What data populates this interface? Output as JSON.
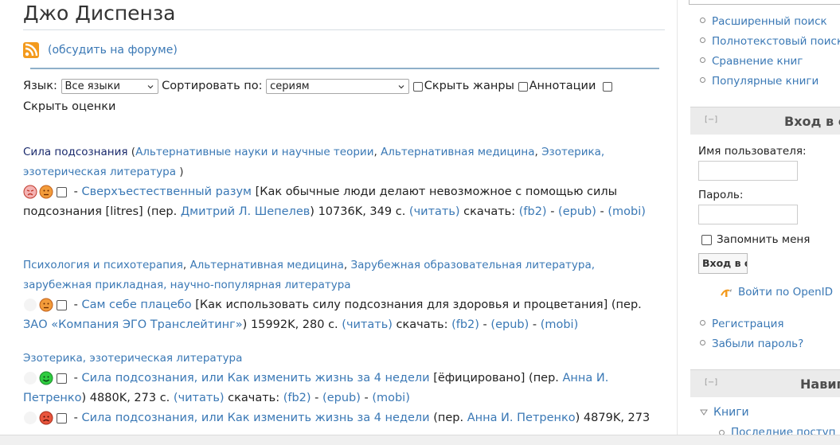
{
  "page": {
    "title": "Джо Диспенза",
    "discuss_link": "(обсудить на форуме)"
  },
  "filters": {
    "language_label": "Язык:",
    "language_value": "Все языки",
    "sort_label": "Сортировать по:",
    "sort_value": "сериям",
    "hide_genres": "Скрыть жанры",
    "annotations": "Аннотации",
    "hide_ratings": "Скрыть оценки"
  },
  "books": [
    {
      "series": "Сила подсознания",
      "genres": [
        "Альтернативные науки и научные теории",
        "Альтернативная медицина",
        "Эзотерика, эзотерическая литература"
      ],
      "rating_face": "red-angry-face-icon",
      "title": "Сверхъестественный разум",
      "subtitle": "[Как обычные люди делают невозможное с помощью силы подсознания [litres]",
      "translator_prefix": "(пер.",
      "translator": "Дмитрий Л. Шепелев",
      "size": "10736K, 349 с.",
      "read": "(читать)",
      "download_label": "скачать:",
      "fb2": "(fb2)",
      "epub": "(epub)",
      "mobi": "(mobi)"
    },
    {
      "genres": [
        "Психология и психотерапия",
        "Альтернативная медицина",
        "Зарубежная образовательная литература, зарубежная прикладная, научно-популярная литература"
      ],
      "title": "Сам себе плацебо",
      "subtitle": "[Как использовать силу подсознания для здоровья и процветания]",
      "translator_prefix": "(пер.",
      "translator": "ЗАО «Компания ЭГО Транслейтинг»",
      "size": "15992K, 280 с.",
      "read": "(читать)",
      "download_label": "скачать:",
      "fb2": "(fb2)",
      "epub": "(epub)",
      "mobi": "(mobi)"
    },
    {
      "genres": [
        "Эзотерика, эзотерическая литература"
      ],
      "title": "Сила подсознания, или Как изменить жизнь за 4 недели",
      "subtitle": "[ёфицировано]",
      "translator_prefix": "(пер.",
      "translator": "Анна И. Петренко",
      "size": "4880K, 273 с.",
      "read": "(читать)",
      "download_label": "скачать:",
      "fb2": "(fb2)",
      "epub": "(epub)",
      "mobi": "(mobi)"
    },
    {
      "title": "Сила подсознания, или Как изменить жизнь за 4 недели",
      "translator_prefix": "(пер.",
      "translator": "Анна И. Петренко",
      "size": "4879K, 273"
    }
  ],
  "sidebar": {
    "links": [
      "Расширенный поиск",
      "Полнотекстовый поиск",
      "Сравнение книг",
      "Популярные книги"
    ],
    "login_block_title": "Вход в с",
    "collapse": "[−]",
    "username_label": "Имя пользователя:",
    "password_label": "Пароль:",
    "remember_me": "Запомнить меня",
    "login_button": "Вход в с",
    "openid": "Войти по OpenID",
    "account_links": [
      "Регистрация",
      "Забыли пароль?"
    ],
    "nav_block_title": "Навиг",
    "nav_item": "Книги",
    "nav_sub": "Последние поступ"
  }
}
